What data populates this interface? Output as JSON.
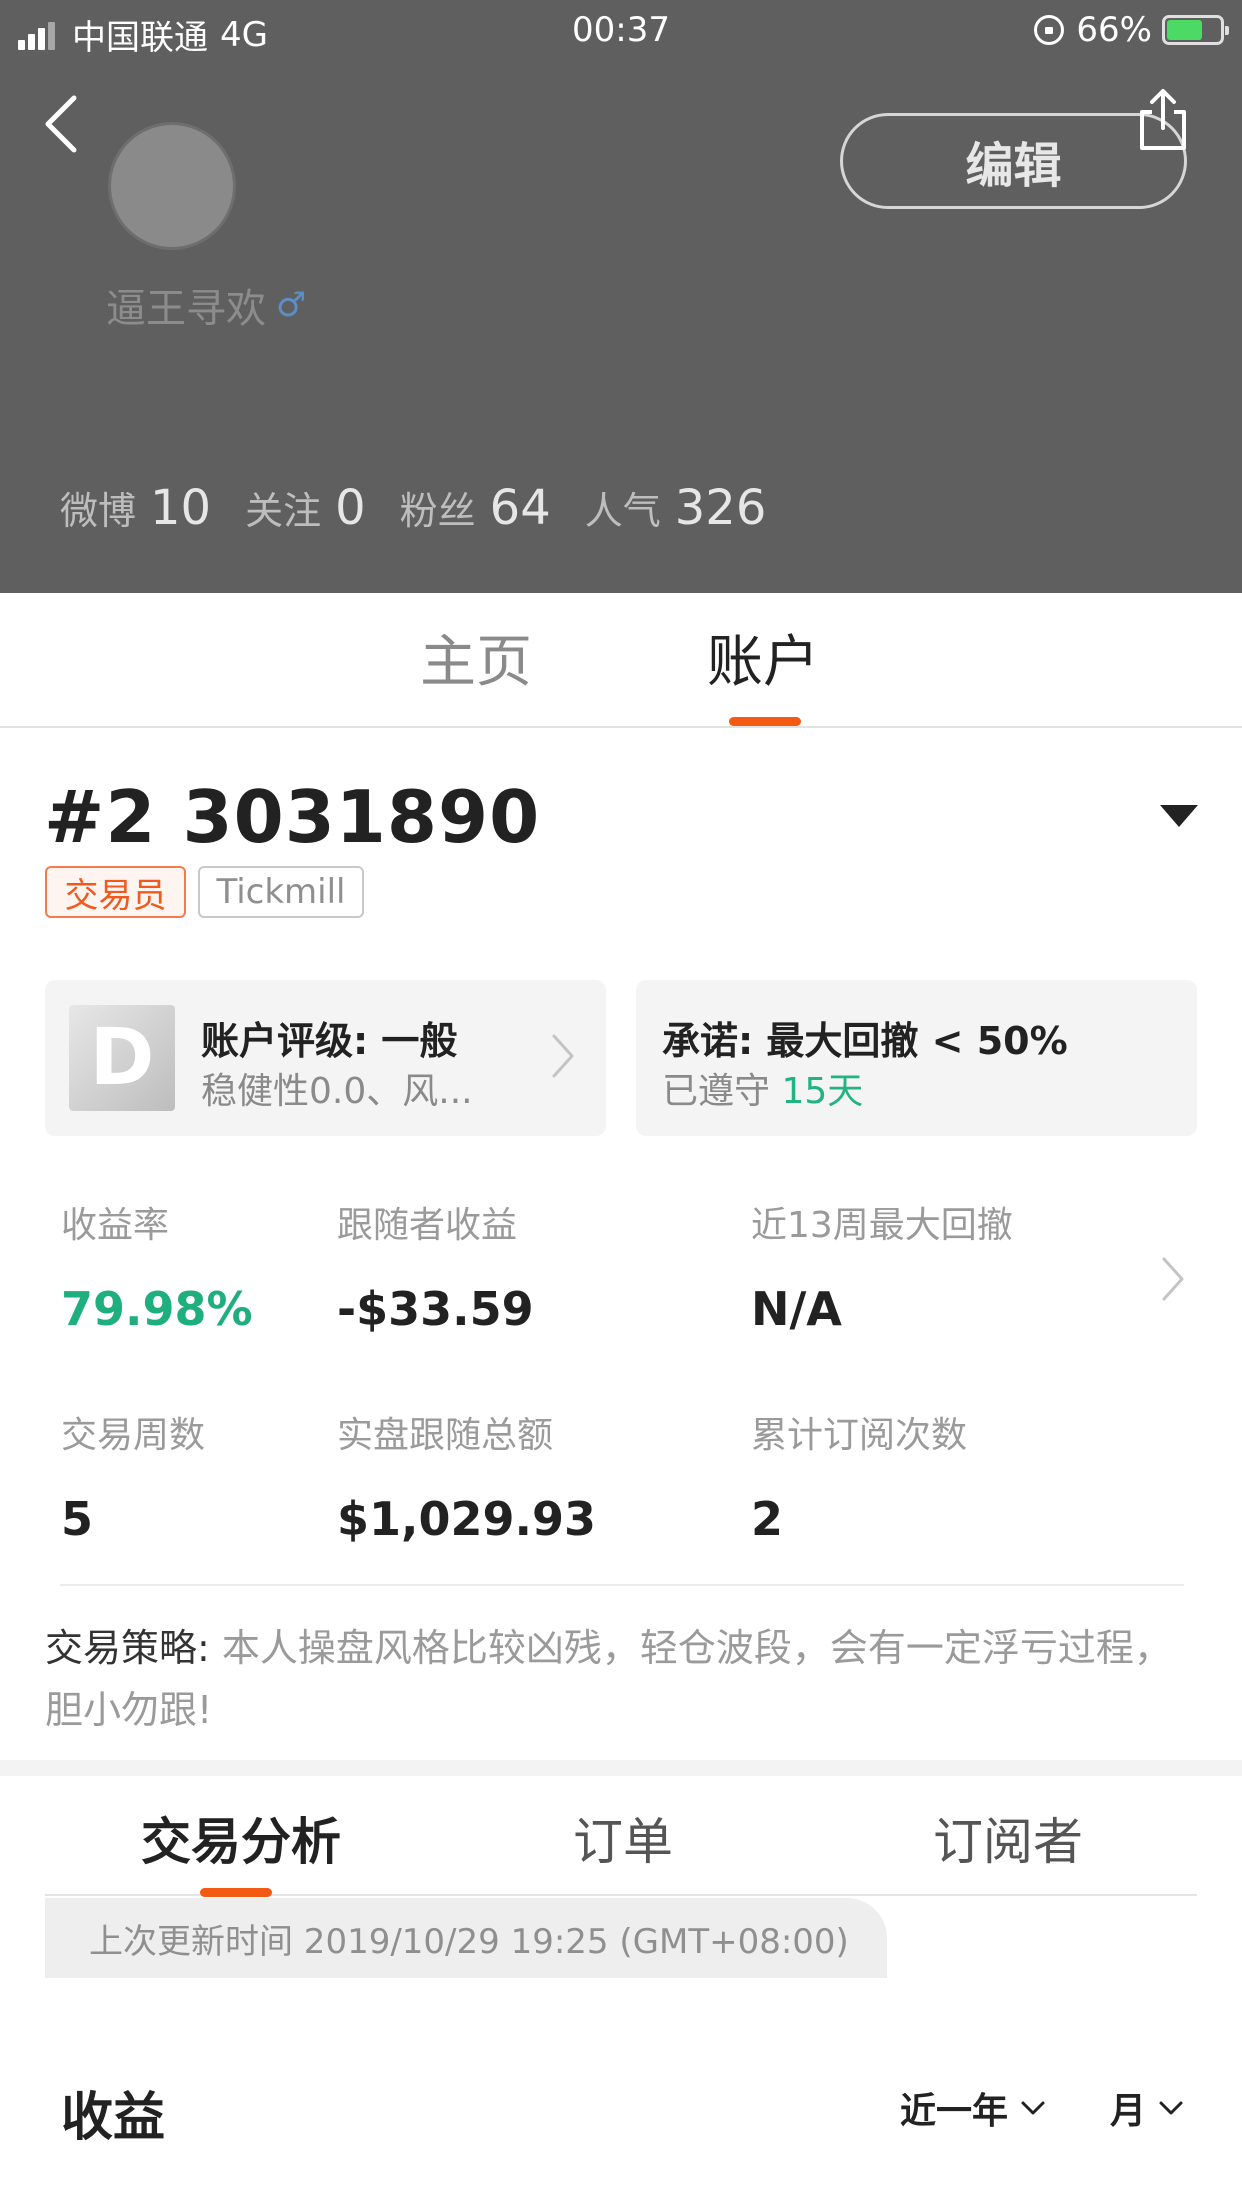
{
  "status_bar": {
    "carrier": "中国联通",
    "network": "4G",
    "time": "00:37",
    "battery": "66%"
  },
  "profile": {
    "username": "逼王寻欢",
    "gender_symbol": "♂",
    "edit_label": "编辑",
    "stats": [
      {
        "label": "微博",
        "value": "10"
      },
      {
        "label": "关注",
        "value": "0"
      },
      {
        "label": "粉丝",
        "value": "64"
      },
      {
        "label": "人气",
        "value": "326"
      }
    ]
  },
  "main_tabs": {
    "home": "主页",
    "account": "账户",
    "active": "account"
  },
  "account": {
    "id": "#2 3031890",
    "badges": {
      "role": "交易员",
      "broker": "Tickmill"
    },
    "rating_card": {
      "letter": "D",
      "title": "账户评级: 一般",
      "subtitle": "稳健性0.0、风..."
    },
    "promise_card": {
      "title": "承诺: 最大回撤 < 50%",
      "sub_prefix": "已遵守",
      "sub_value": "15天"
    },
    "metrics": [
      {
        "label": "收益率",
        "value": "79.98%"
      },
      {
        "label": "跟随者收益",
        "value": "-$33.59"
      },
      {
        "label": "近13周最大回撤",
        "value": "N/A"
      },
      {
        "label": "交易周数",
        "value": "5"
      },
      {
        "label": "实盘跟随总额",
        "value": "$1,029.93"
      },
      {
        "label": "累计订阅次数",
        "value": "2"
      }
    ],
    "strategy_label": "交易策略:",
    "strategy_text": "本人操盘风格比较凶残，轻仓波段，会有一定浮亏过程，胆小勿跟!"
  },
  "sub_tabs": {
    "items": [
      "交易分析",
      "订单",
      "订阅者"
    ],
    "active": "交易分析"
  },
  "update_time": "上次更新时间 2019/10/29 19:25 (GMT+08:00)",
  "profit_section": {
    "title": "收益",
    "range_select": "近一年",
    "unit_select": "月"
  },
  "colors": {
    "accent": "#f45a14",
    "positive": "#1fae7e",
    "header_bg": "#5f5f5f"
  }
}
